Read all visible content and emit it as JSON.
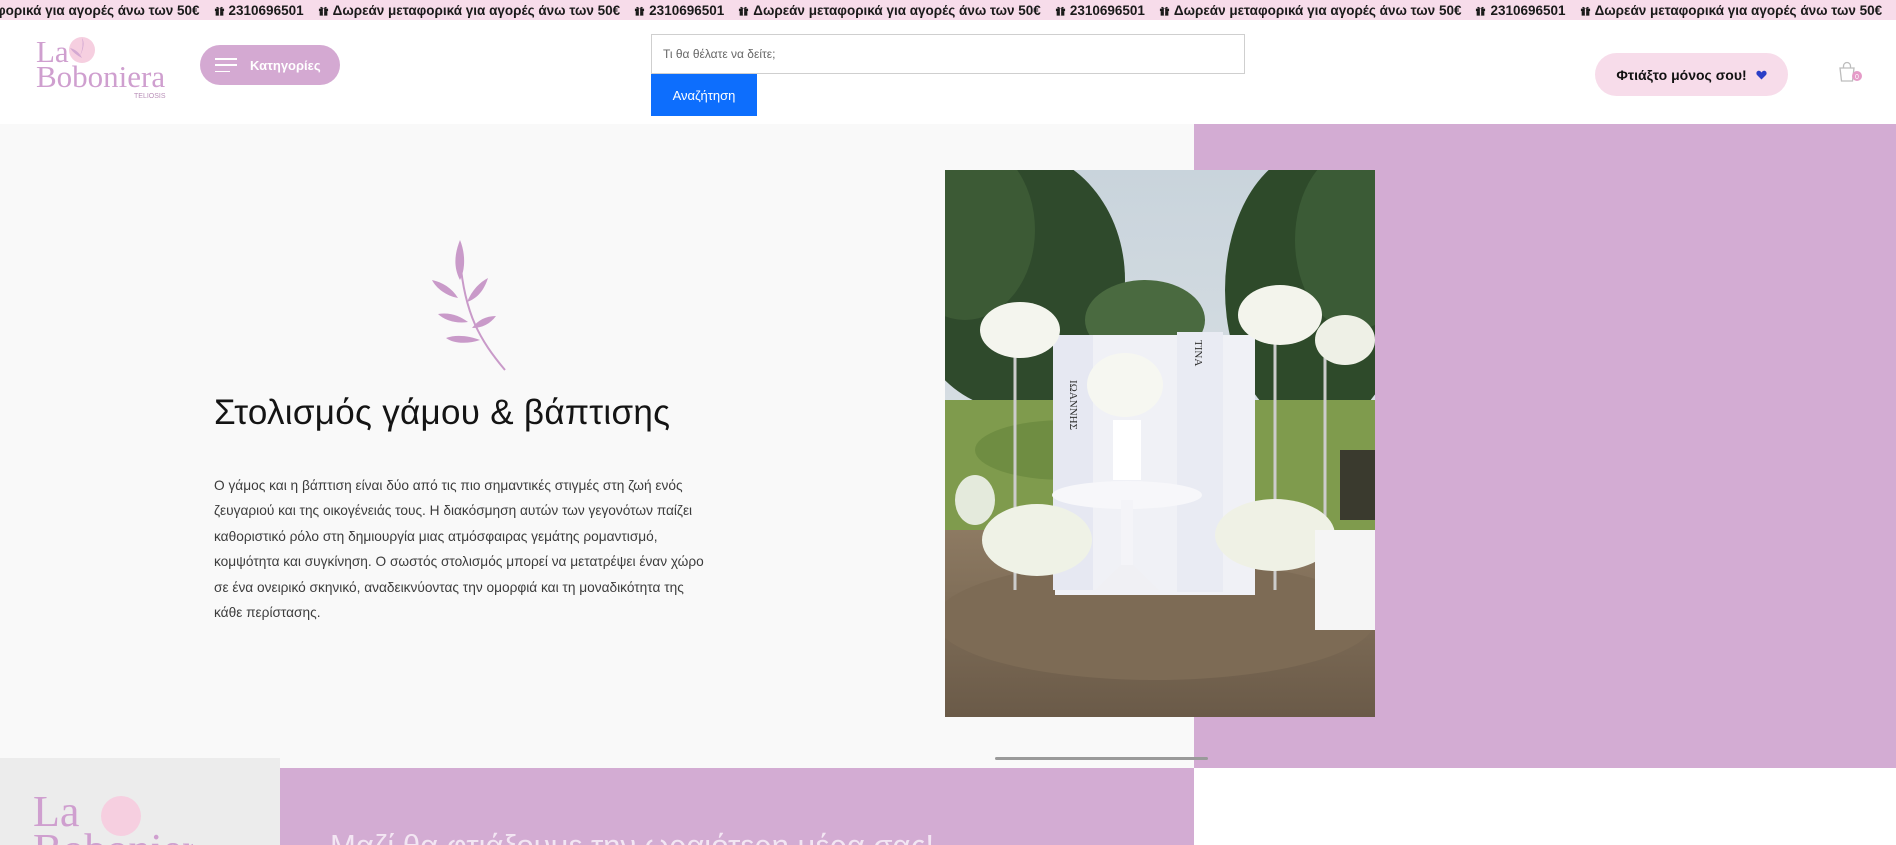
{
  "ticker": {
    "items": [
      {
        "type": "text",
        "text": "φορικά για αγορές άνω των 50€"
      },
      {
        "type": "gift",
        "text": "2310696501"
      },
      {
        "type": "gift",
        "text": "Δωρεάν μεταφορικά για αγορές άνω των 50€"
      },
      {
        "type": "gift",
        "text": "2310696501"
      },
      {
        "type": "gift",
        "text": "Δωρεάν μεταφορικά για αγορές άνω των 50€"
      },
      {
        "type": "gift",
        "text": "2310696501"
      },
      {
        "type": "gift",
        "text": "Δωρεάν μεταφορικά για αγορές άνω των 50€"
      },
      {
        "type": "gift",
        "text": "2310696501"
      },
      {
        "type": "gift",
        "text": "Δωρεάν μεταφορικά για αγορές άνω των 50€"
      },
      {
        "type": "gift",
        "text": "2310696501"
      }
    ]
  },
  "header": {
    "logo": {
      "line1": "La",
      "line2": "Boboniera",
      "tagline": "TELIOSIS"
    },
    "categories_label": "Κατηγορίες",
    "search_placeholder": "Τι θα θέλατε να δείτε;",
    "search_button": "Αναζήτηση",
    "make_yourself_label": "Φτιάξτο μόνος σου!",
    "cart_count": "0"
  },
  "hero": {
    "title": "Στολισμός γάμου & βάπτισης",
    "body": "Ο γάμος και η βάπτιση είναι δύο από τις πιο σημαντικές στιγμές στη ζωή ενός ζευγαριού και της οικογένειάς τους. Η διακόσμηση αυτών των γεγονότων παίζει καθοριστικό ρόλο στη δημιουργία μιας ατμόσφαιρας γεμάτης ρομαντισμό, κομψότητα και συγκίνηση. Ο σωστός στολισμός μπορεί να μετατρέψει έναν χώρο σε ένα ονειρικό σκηνικό, αναδεικνύοντας την ομορφιά και τη μοναδικότητα της κάθε περίστασης.",
    "photo_names": {
      "left": "ΙΩΑΝΝΗΣ",
      "right": "ΤΙΝΑ"
    }
  },
  "bottom": {
    "heading": "Μαζί θα φτιάξουμε την ωραιότερη μέρα σας!"
  },
  "colors": {
    "brand_pink": "#d4a9d2",
    "ticker_bg": "#f7dcea",
    "search_blue": "#0d6efd",
    "heart_blue": "#2b3fc7"
  },
  "icons": [
    "gift-icon",
    "menu-icon",
    "heart-icon",
    "cart-icon",
    "leaf-icon"
  ]
}
